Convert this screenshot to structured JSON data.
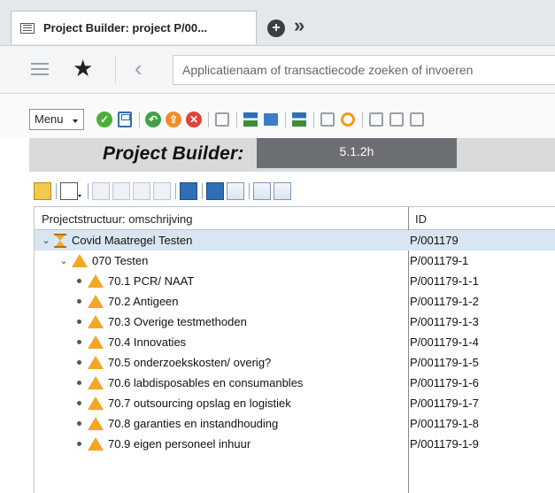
{
  "tabbar": {
    "tab_title": "Project Builder: project P/00...",
    "new_tab_icon": "plus-circle-icon",
    "more_icon": "double-chevron-right-icon"
  },
  "shell": {
    "menu_icon": "hamburger-icon",
    "favorite_icon": "star-icon",
    "back_icon": "chevron-left-icon",
    "search_placeholder": "Applicatienaam of transactiecode zoeken of invoeren"
  },
  "app_toolbar": {
    "menu_label": "Menu"
  },
  "title": {
    "text": "Project Builder:",
    "version": "5.1.2h"
  },
  "tree": {
    "col_description": "Projectstructuur: omschrijving",
    "col_id": "ID",
    "rows": [
      {
        "label": "Covid Maatregel Testen",
        "id": "P/001179",
        "level": 0,
        "icon": "project-hourglass-icon",
        "node": "expanded"
      },
      {
        "label": "070 Testen",
        "id": "P/001179-1",
        "level": 1,
        "icon": "warning-triangle-icon",
        "node": "expanded"
      },
      {
        "label": "70.1 PCR/ NAAT",
        "id": "P/001179-1-1",
        "level": 2,
        "icon": "warning-triangle-icon",
        "node": "leaf"
      },
      {
        "label": "70.2 Antigeen",
        "id": "P/001179-1-2",
        "level": 2,
        "icon": "warning-triangle-icon",
        "node": "leaf"
      },
      {
        "label": "70.3 Overige testmethoden",
        "id": "P/001179-1-3",
        "level": 2,
        "icon": "warning-triangle-icon",
        "node": "leaf"
      },
      {
        "label": "70.4 Innovaties",
        "id": "P/001179-1-4",
        "level": 2,
        "icon": "warning-triangle-icon",
        "node": "leaf"
      },
      {
        "label": "70.5 onderzoekskosten/ overig?",
        "id": "P/001179-1-5",
        "level": 2,
        "icon": "warning-triangle-icon",
        "node": "leaf"
      },
      {
        "label": "70.6 labdisposables en consumanbles",
        "id": "P/001179-1-6",
        "level": 2,
        "icon": "warning-triangle-icon",
        "node": "leaf"
      },
      {
        "label": "70.7 outsourcing opslag en logistiek",
        "id": "P/001179-1-7",
        "level": 2,
        "icon": "warning-triangle-icon",
        "node": "leaf"
      },
      {
        "label": "70.8 garanties en instandhouding",
        "id": "P/001179-1-8",
        "level": 2,
        "icon": "warning-triangle-icon",
        "node": "leaf"
      },
      {
        "label": "70.9 eigen personeel inhuur",
        "id": "P/001179-1-9",
        "level": 2,
        "icon": "warning-triangle-icon",
        "node": "leaf"
      }
    ]
  },
  "colors": {
    "selected_row": "#d8e6f3",
    "warning_triangle": "#f5a623",
    "title_bar": "#d9dadb",
    "version_box": "#6b6e72"
  }
}
